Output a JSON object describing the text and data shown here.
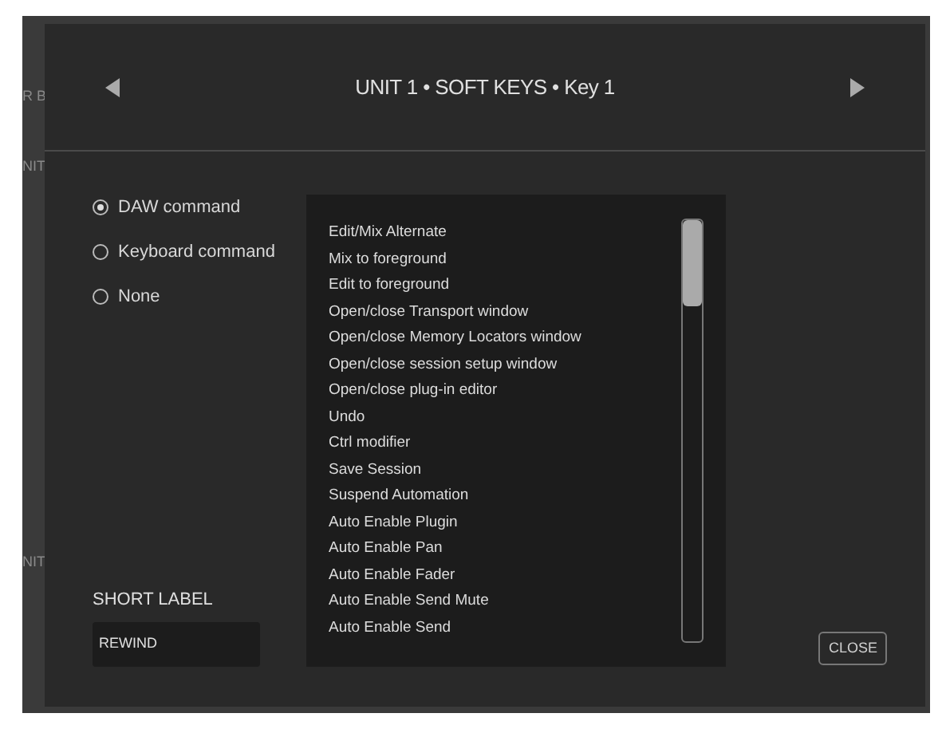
{
  "background": {
    "labels": [
      "R B",
      "NIT",
      "NIT"
    ]
  },
  "dialog": {
    "title": "UNIT 1 • SOFT KEYS • Key 1",
    "command_type": [
      {
        "label": "DAW command",
        "selected": true
      },
      {
        "label": "Keyboard command",
        "selected": false
      },
      {
        "label": "None",
        "selected": false
      }
    ],
    "short_label": {
      "label": "SHORT LABEL",
      "value": "REWIND"
    },
    "commands": [
      "Edit/Mix Alternate",
      "Mix to foreground",
      "Edit to foreground",
      "Open/close Transport window",
      "Open/close Memory Locators window",
      "Open/close session setup window",
      "Open/close plug-in editor",
      "Undo",
      "Ctrl modifier",
      "Save Session",
      "Suspend Automation",
      "Auto Enable Plugin",
      "Auto Enable Pan",
      "Auto Enable Fader",
      "Auto Enable Send Mute",
      "Auto Enable Send"
    ],
    "close_button": "CLOSE"
  }
}
